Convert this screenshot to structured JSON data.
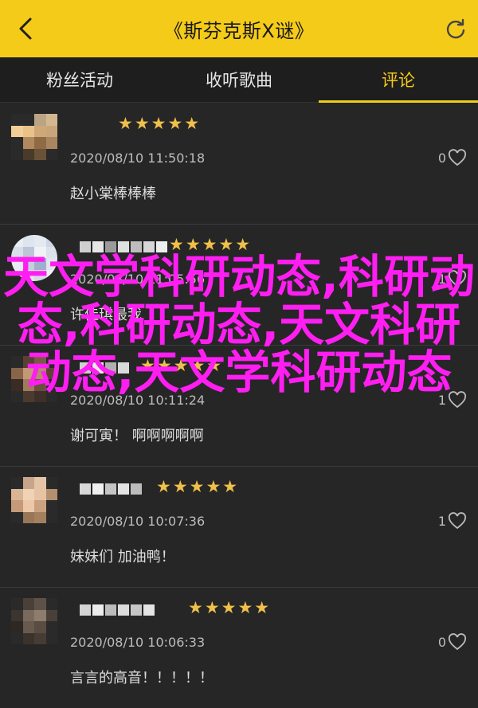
{
  "header": {
    "title": "《斯芬克斯Ⅹ谜》"
  },
  "tabs": [
    {
      "label": "粉丝活动",
      "active": false
    },
    {
      "label": "收听歌曲",
      "active": false
    },
    {
      "label": "评论",
      "active": true
    }
  ],
  "comments": [
    {
      "stars": "★★★★★",
      "rating": 5,
      "date": "2020/08/10 11:50:18",
      "likes": "0",
      "text": "赵小棠棒棒棒"
    },
    {
      "stars": "★★★★★",
      "rating": 5,
      "date": "2020/08/10 11:05:56",
      "likes": "1",
      "text": "许佳琪最我"
    },
    {
      "stars": "★★★★★",
      "rating": 5,
      "date": "2020/08/10 10:11:24",
      "likes": "1",
      "text": "谢可寅！ 啊啊啊啊啊"
    },
    {
      "stars": "★★★★★",
      "rating": 5,
      "date": "2020/08/10 10:07:36",
      "likes": "1",
      "text": "妹妹们 加油鸭！"
    },
    {
      "stars": "★★★★★",
      "rating": 5,
      "date": "2020/08/10 10:06:33",
      "likes": "0",
      "text": "言言的高音！！！！！"
    }
  ],
  "overlay_text": "天文学科研动态,科研动态,科研动态,天文科研动态,天文学科研动态",
  "colors": {
    "accent": "#f5cb19",
    "overlay": "#ff1ef2",
    "star": "#f0c04a"
  },
  "icons": {
    "back": "chevron-left-icon",
    "refresh": "refresh-icon",
    "like": "heart-outline-icon"
  }
}
